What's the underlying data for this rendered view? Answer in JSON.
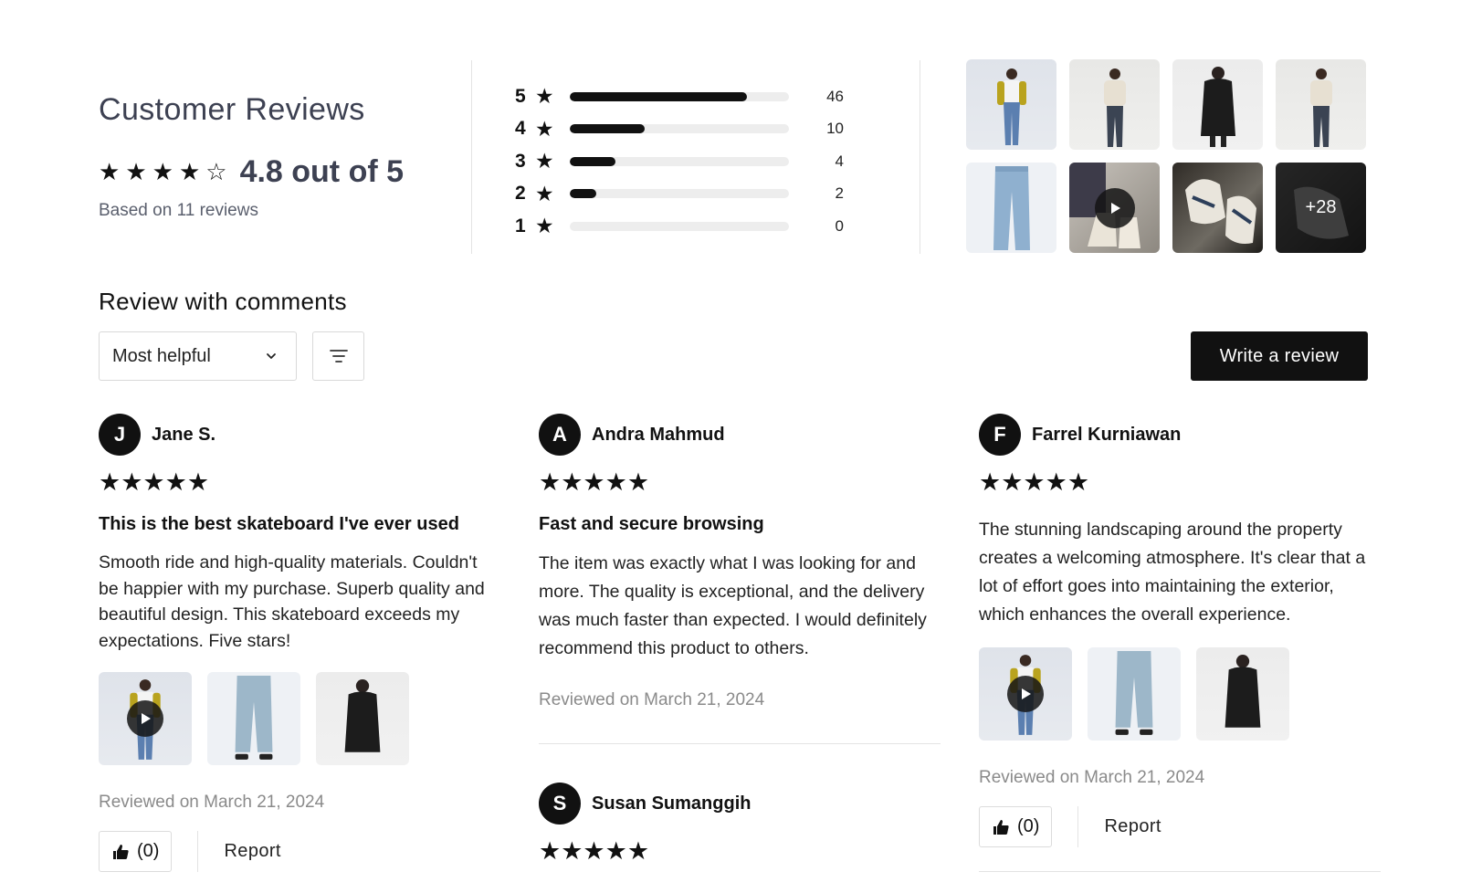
{
  "summary": {
    "title": "Customer Reviews",
    "rating_stars": [
      "★",
      "★",
      "★",
      "★",
      "☆"
    ],
    "rating_text": "4.8 out of 5",
    "based_on": "Based on 11 reviews"
  },
  "distribution": [
    {
      "stars": "5",
      "count": "46",
      "fraction": 0.81
    },
    {
      "stars": "4",
      "count": "10",
      "fraction": 0.34
    },
    {
      "stars": "3",
      "count": "4",
      "fraction": 0.21
    },
    {
      "stars": "2",
      "count": "2",
      "fraction": 0.12
    },
    {
      "stars": "1",
      "count": "0",
      "fraction": 0.0
    }
  ],
  "gallery": {
    "more_label": "+28"
  },
  "comments": {
    "title": "Review with comments",
    "sort_value": "Most helpful",
    "write_button": "Write a review"
  },
  "reviews": [
    {
      "initial": "J",
      "name": "Jane S.",
      "stars": "★★★★★",
      "title": "This is the best skateboard I've ever used",
      "body": "Smooth ride and high-quality materials. Couldn't be happier with my purchase. Superb quality and beautiful design. This skateboard exceeds my expectations. Five stars!",
      "reviewed": "Reviewed on March 21, 2024",
      "helpful": "(0)",
      "report": "Report"
    },
    {
      "initial": "A",
      "name": "Andra Mahmud",
      "stars": "★★★★★",
      "title": "Fast and secure browsing",
      "body": "The item was exactly what I was looking for and more. The quality is exceptional, and the delivery was much faster than expected. I would definitely recommend this product to others.",
      "reviewed": "Reviewed on March 21, 2024"
    },
    {
      "initial": "S",
      "name": "Susan Sumanggih",
      "stars": "★★★★★"
    },
    {
      "initial": "F",
      "name": "Farrel Kurniawan",
      "stars": "★★★★★",
      "body": "The stunning landscaping around the property creates a welcoming atmosphere. It's clear that a lot of effort goes into maintaining the exterior, which enhances the overall experience.",
      "reviewed": "Reviewed on March 21, 2024",
      "helpful": "(0)",
      "report": "Report"
    }
  ]
}
